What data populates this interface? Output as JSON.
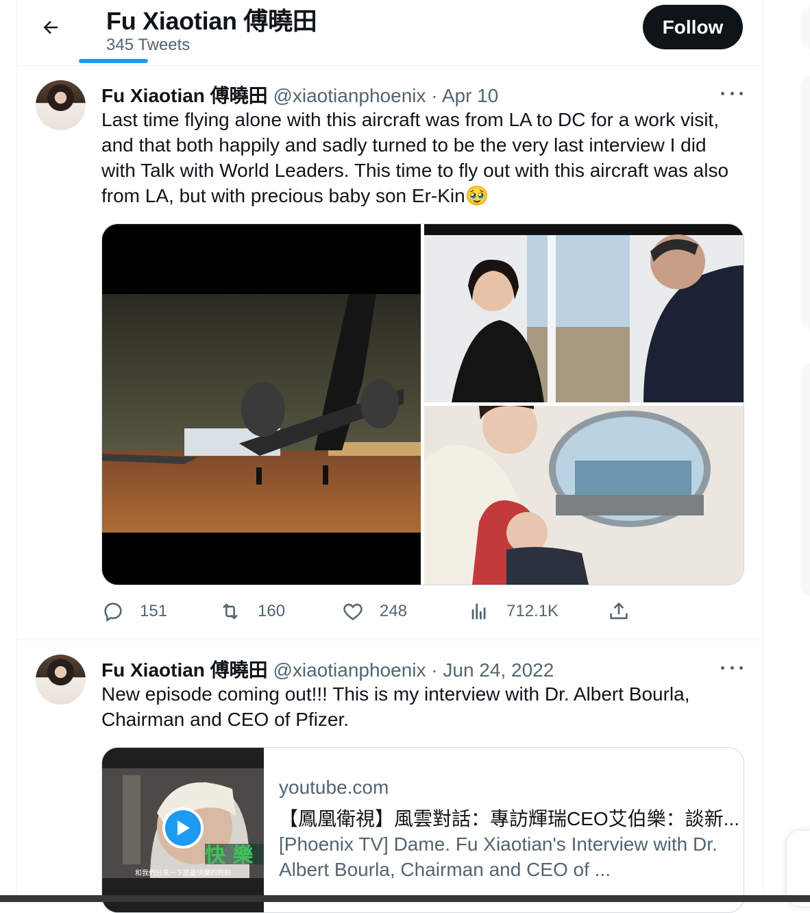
{
  "header": {
    "title": "Fu Xiaotian 傅曉田",
    "tweet_count": "345 Tweets",
    "follow_label": "Follow"
  },
  "tweets": [
    {
      "name": "Fu Xiaotian 傅曉田",
      "handle": "@xiaotianphoenix",
      "separator": "·",
      "date": "Apr 10",
      "text": "Last time flying alone with this aircraft was from LA to DC for a work visit, and that both happily and sadly turned to be the very last interview I did with Talk with World Leaders. This time to fly out with this aircraft was also from LA, but with precious baby son Er-Kin🥹",
      "stats": {
        "replies": "151",
        "retweets": "160",
        "likes": "248",
        "views": "712.1K"
      }
    },
    {
      "name": "Fu Xiaotian 傅曉田",
      "handle": "@xiaotianphoenix",
      "separator": "·",
      "date": "Jun 24, 2022",
      "text": "New episode coming out!!! This is my interview with Dr. Albert Bourla, Chairman and CEO of Pfizer.",
      "card": {
        "domain": "youtube.com",
        "title": "【鳳凰衛視】風雲對話：專訪輝瑞CEO艾伯樂：談新...",
        "description": "[Phoenix TV] Dame. Fu Xiaotian's Interview with Dr. Albert Bourla, Chairman and CEO of ...",
        "thumb_caption": "和我們分享一下您最快樂的時刻",
        "thumb_overlay": "快 樂"
      }
    }
  ],
  "colors": {
    "accent": "#1d9bf0",
    "text": "#0f1419",
    "secondary": "#536471",
    "border": "#eff3f4"
  },
  "icons": [
    "back-arrow-icon",
    "more-icon",
    "reply-icon",
    "retweet-icon",
    "like-icon",
    "views-icon",
    "share-icon",
    "play-icon"
  ]
}
